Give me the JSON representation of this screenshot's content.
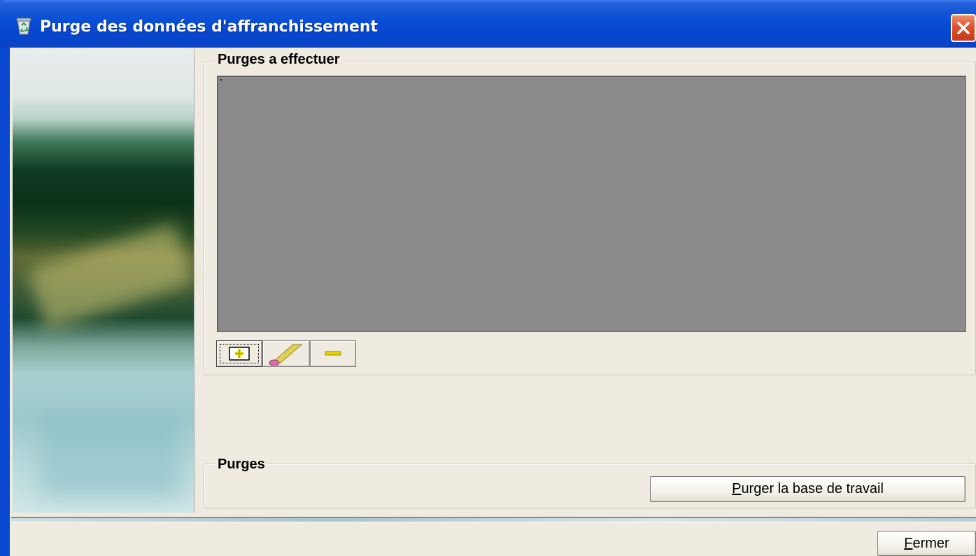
{
  "window": {
    "title": "Purge des données d'affranchissement",
    "colors": {
      "titlebar": "#0a4fd6",
      "client_bg": "#efebe0",
      "list_bg": "#8c8a8c",
      "close": "#e0502a"
    },
    "icons": {
      "title": "recycle-bin-icon",
      "close": "close-icon"
    }
  },
  "purges_a_effectuer": {
    "legend": "Purges a effectuer",
    "list_items": [],
    "toolbar": [
      {
        "name": "add-button",
        "icon": "plus-icon"
      },
      {
        "name": "edit-button",
        "icon": "pencil-icon"
      },
      {
        "name": "remove-button",
        "icon": "minus-icon"
      }
    ]
  },
  "purges": {
    "legend": "Purges",
    "purge_button_mnemonic": "P",
    "purge_button_rest": "urger la base de travail"
  },
  "footer": {
    "close_mnemonic": "F",
    "close_rest": "ermer"
  }
}
